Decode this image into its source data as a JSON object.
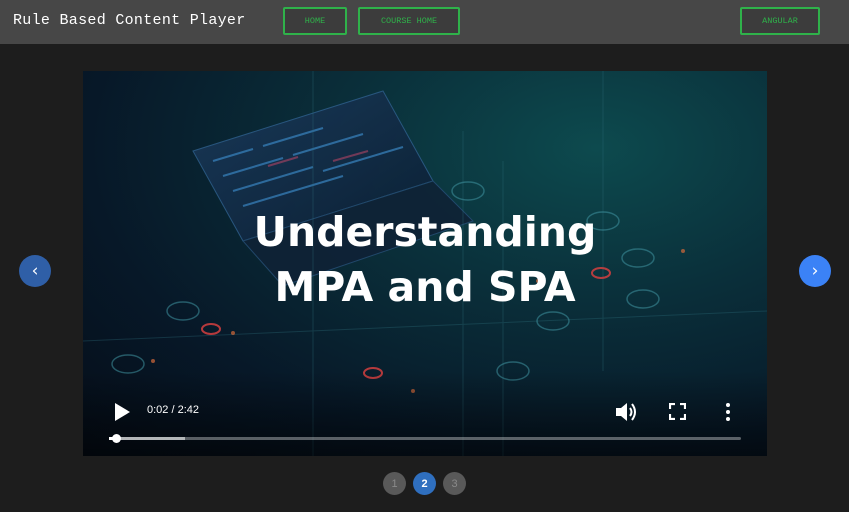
{
  "header": {
    "title": "Rule Based Content Player",
    "nav": {
      "home": "HOME",
      "course_home": "COURSE HOME",
      "angular": "ANGULAR"
    }
  },
  "carousel": {
    "prev_icon": "chevron-left-icon",
    "next_icon": "chevron-right-icon",
    "prev_symbol": "‹",
    "next_symbol": "›",
    "slide_title_line1": "Understanding",
    "slide_title_line2": "MPA and SPA",
    "pages": [
      "1",
      "2",
      "3"
    ],
    "active_page": "2"
  },
  "video_player": {
    "time_display": "0:02 / 2:42",
    "current_seconds": 2,
    "duration_seconds": 162,
    "buffered_fraction": 0.12,
    "icons": {
      "play": "play-icon",
      "volume": "volume-icon",
      "fullscreen": "fullscreen-icon",
      "more": "more-vert-icon"
    }
  },
  "colors": {
    "header_bg": "#474747",
    "page_bg": "#1d1d1d",
    "nav_accent": "#2fb24a",
    "active_page": "#2f6fbf",
    "arrow_next": "#3b82f6",
    "arrow_prev": "#2f5fa7"
  }
}
